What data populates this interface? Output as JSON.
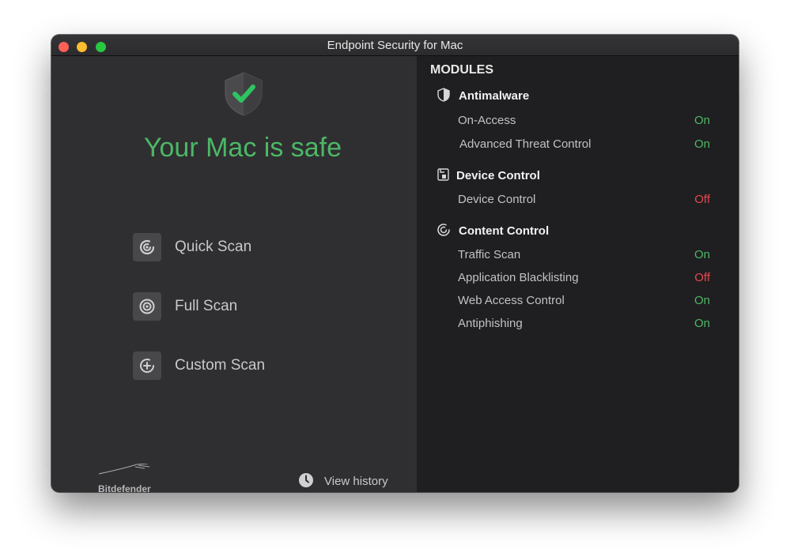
{
  "window": {
    "title": "Endpoint Security for Mac"
  },
  "status": {
    "title": "Your Mac is safe"
  },
  "scans": [
    {
      "label": "Quick Scan"
    },
    {
      "label": "Full Scan"
    },
    {
      "label": "Custom Scan"
    }
  ],
  "brand": {
    "name": "Bitdefender"
  },
  "history": {
    "label": "View history"
  },
  "modules": {
    "heading": "MODULES",
    "groups": [
      {
        "title": "Antimalware",
        "icon": "shield-icon",
        "items": [
          {
            "label": "On-Access",
            "status": "On"
          },
          {
            "label": "Advanced Threat Control",
            "status": "On"
          }
        ]
      },
      {
        "title": "Device Control",
        "icon": "device-icon",
        "items": [
          {
            "label": "Device Control",
            "status": "Off"
          }
        ]
      },
      {
        "title": "Content Control",
        "icon": "content-control-icon",
        "items": [
          {
            "label": "Traffic Scan",
            "status": "On"
          },
          {
            "label": "Application Blacklisting",
            "status": "Off"
          },
          {
            "label": "Web Access Control",
            "status": "On"
          },
          {
            "label": "Antiphishing",
            "status": "On"
          }
        ]
      }
    ]
  },
  "colors": {
    "safe": "#4cb865",
    "off": "#e5484d",
    "right_pane": "#1f1f21",
    "left_pane": "#2f2f32"
  }
}
